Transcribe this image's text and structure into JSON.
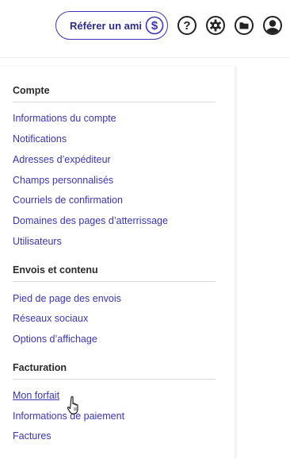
{
  "header": {
    "refer_label": "Référer un ami",
    "icons": [
      "dollar-icon",
      "help-icon",
      "gear-icon",
      "folder-icon",
      "user-avatar-icon"
    ],
    "accent_color": "#3b35b5"
  },
  "menu": {
    "sections": [
      {
        "title": "Compte",
        "items": [
          "Informations du compte",
          "Notifications",
          "Adresses d’expéditeur",
          "Champs personnalisés",
          "Courriels de confirmation",
          "Domaines des pages d’atterrissage",
          "Utilisateurs"
        ]
      },
      {
        "title": "Envois et contenu",
        "items": [
          "Pied de page des envois",
          "Réseaux sociaux",
          "Options d’affichage"
        ]
      },
      {
        "title": "Facturation",
        "items": [
          "Mon forfait",
          "Informations de paiement",
          "Factures"
        ]
      }
    ],
    "hovered_item": "Mon forfait"
  }
}
